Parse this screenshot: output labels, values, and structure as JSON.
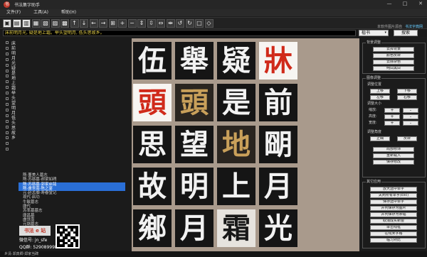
{
  "app": {
    "title": "书法集字助手",
    "minimize": "—",
    "maximize": "□",
    "close": "✕"
  },
  "menu": [
    "文件(F)",
    "工具(A)",
    "帮助(H)"
  ],
  "toolbar": {
    "icons": [
      "new-file-icon",
      "open-file-icon",
      "save-icon",
      "export-icon",
      "image-icon",
      "save-as-icon",
      "edit-icon",
      "arrow-up-icon",
      "arrow-down-icon",
      "arrow-left-icon",
      "arrow-right-icon",
      "grid-icon",
      "zoom-in-icon",
      "zoom-out-icon",
      "expand-vertical-icon",
      "shrink-vertical-icon",
      "expand-horizontal-icon",
      "shrink-horizontal-icon",
      "rotate-left-icon",
      "rotate-right-icon",
      "frame-icon",
      "reset-icon"
    ],
    "glyphs": [
      "▣",
      "▤",
      "▥",
      "▦",
      "▧",
      "▨",
      "▩",
      "↑",
      "↓",
      "←",
      "→",
      "⊞",
      "+",
      "−",
      "⇕",
      "⇳",
      "⇔",
      "⇹",
      "↺",
      "↻",
      "□",
      "◇"
    ],
    "notice": "本软件图片源自",
    "notice_link": "书法字典网"
  },
  "input": {
    "text": "床前明月光, 疑是地上霜。举头望明月, 低头思故乡。",
    "font": "楷书",
    "font_arrow": "▾",
    "search_label": "搜索"
  },
  "tree": {
    "root_text": "床前明月光疑是地上霜举头望明月低头思故乡",
    "children": [
      "隋·董美人墓志",
      "隋·苏慈墓·郝梁如碑",
      "隋·苏慈墓·郭家启铭",
      "隋·虞世南·陈之宴",
      "元·赵孟頫·寿春堂记",
      "现代·启功",
      "牛敏墓志",
      "唐代",
      "苏率墓墓志",
      "唐昌墓",
      "虞世南",
      "元钢墓志"
    ],
    "selected_indexes": [
      2,
      3
    ]
  },
  "logo_text": "书法 e 站",
  "wechat": {
    "line1": "微信号: jn_sfe",
    "line2": "QQ群: 529089998"
  },
  "grid": [
    {
      "char": "伍",
      "style": "blk"
    },
    {
      "char": "舉",
      "style": "blk"
    },
    {
      "char": "疑",
      "style": "blk"
    },
    {
      "char": "牀",
      "style": "wht"
    },
    {
      "char": "頭",
      "style": "wht"
    },
    {
      "char": "頭",
      "style": "brn"
    },
    {
      "char": "是",
      "style": "blk"
    },
    {
      "char": "前",
      "style": "blk"
    },
    {
      "char": "思",
      "style": "blk"
    },
    {
      "char": "望",
      "style": "blk"
    },
    {
      "char": "地",
      "style": "brn"
    },
    {
      "char": "朙",
      "style": "blk"
    },
    {
      "char": "故",
      "style": "blk"
    },
    {
      "char": "明",
      "style": "blk"
    },
    {
      "char": "上",
      "style": "blk"
    },
    {
      "char": "月",
      "style": "blk"
    },
    {
      "char": "鄉",
      "style": "blk"
    },
    {
      "char": "月",
      "style": "blk"
    },
    {
      "char": "霜",
      "style": "gry"
    },
    {
      "char": "光",
      "style": "blk"
    }
  ],
  "right": {
    "group1_title": "背景调整",
    "group1_buttons": [
      "去掉背景",
      "颜色反转",
      "去除杂色",
      "纯白黑白"
    ],
    "group2_title": "图像调整",
    "pos_label": "调整位置",
    "pos_buttons": [
      "上移",
      "下移",
      "左移",
      "右移"
    ],
    "size_label": "调整大小",
    "size_rows": [
      "缩放:",
      "高度:",
      "宽度:"
    ],
    "plus": "+",
    "minus": "-",
    "align_label": "调整角度",
    "align_buttons": [
      "正确",
      "反转"
    ],
    "action_buttons": [
      "局部修饰",
      "重新载入",
      "保存修改"
    ],
    "group3_title": "其它应用",
    "other_buttons": [
      "放大选中单字",
      "关闭所有单字(Esc)",
      "保存选中单字",
      "并列保存为图片",
      "并列保存为条幅",
      "取消成实新窗",
      "单击线框",
      "在线米字格",
      "临习对比"
    ]
  },
  "status": "乡清·郑真卿·郑家当碑"
}
